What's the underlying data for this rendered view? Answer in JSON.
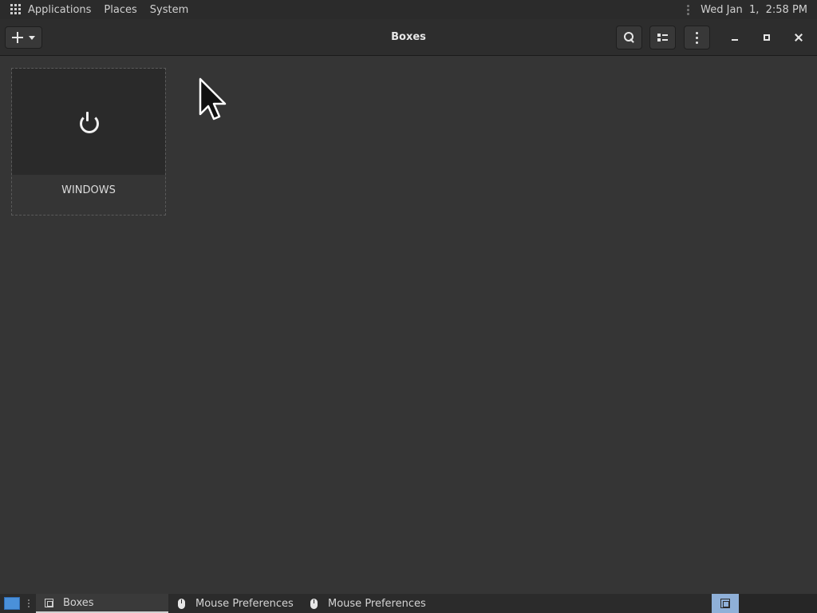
{
  "top_panel": {
    "menus": [
      "Applications",
      "Places",
      "System"
    ],
    "clock": "Wed Jan  1,  2:58 PM"
  },
  "window": {
    "title": "Boxes",
    "new_button_icon": "plus-icon",
    "controls": [
      "minimize-icon",
      "maximize-icon",
      "close-icon"
    ]
  },
  "boxes": [
    {
      "name": "WINDOWS",
      "state_icon": "power-icon"
    }
  ],
  "taskbar": {
    "tasks": [
      {
        "label": "Boxes",
        "icon": "boxes-icon",
        "active": true
      },
      {
        "label": "Mouse Preferences",
        "icon": "mouse-icon",
        "active": false
      },
      {
        "label": "Mouse Preferences",
        "icon": "mouse-icon",
        "active": false
      }
    ],
    "show_desktop_color": "#4a90d9",
    "workspace_color": "#8fb0d8"
  }
}
